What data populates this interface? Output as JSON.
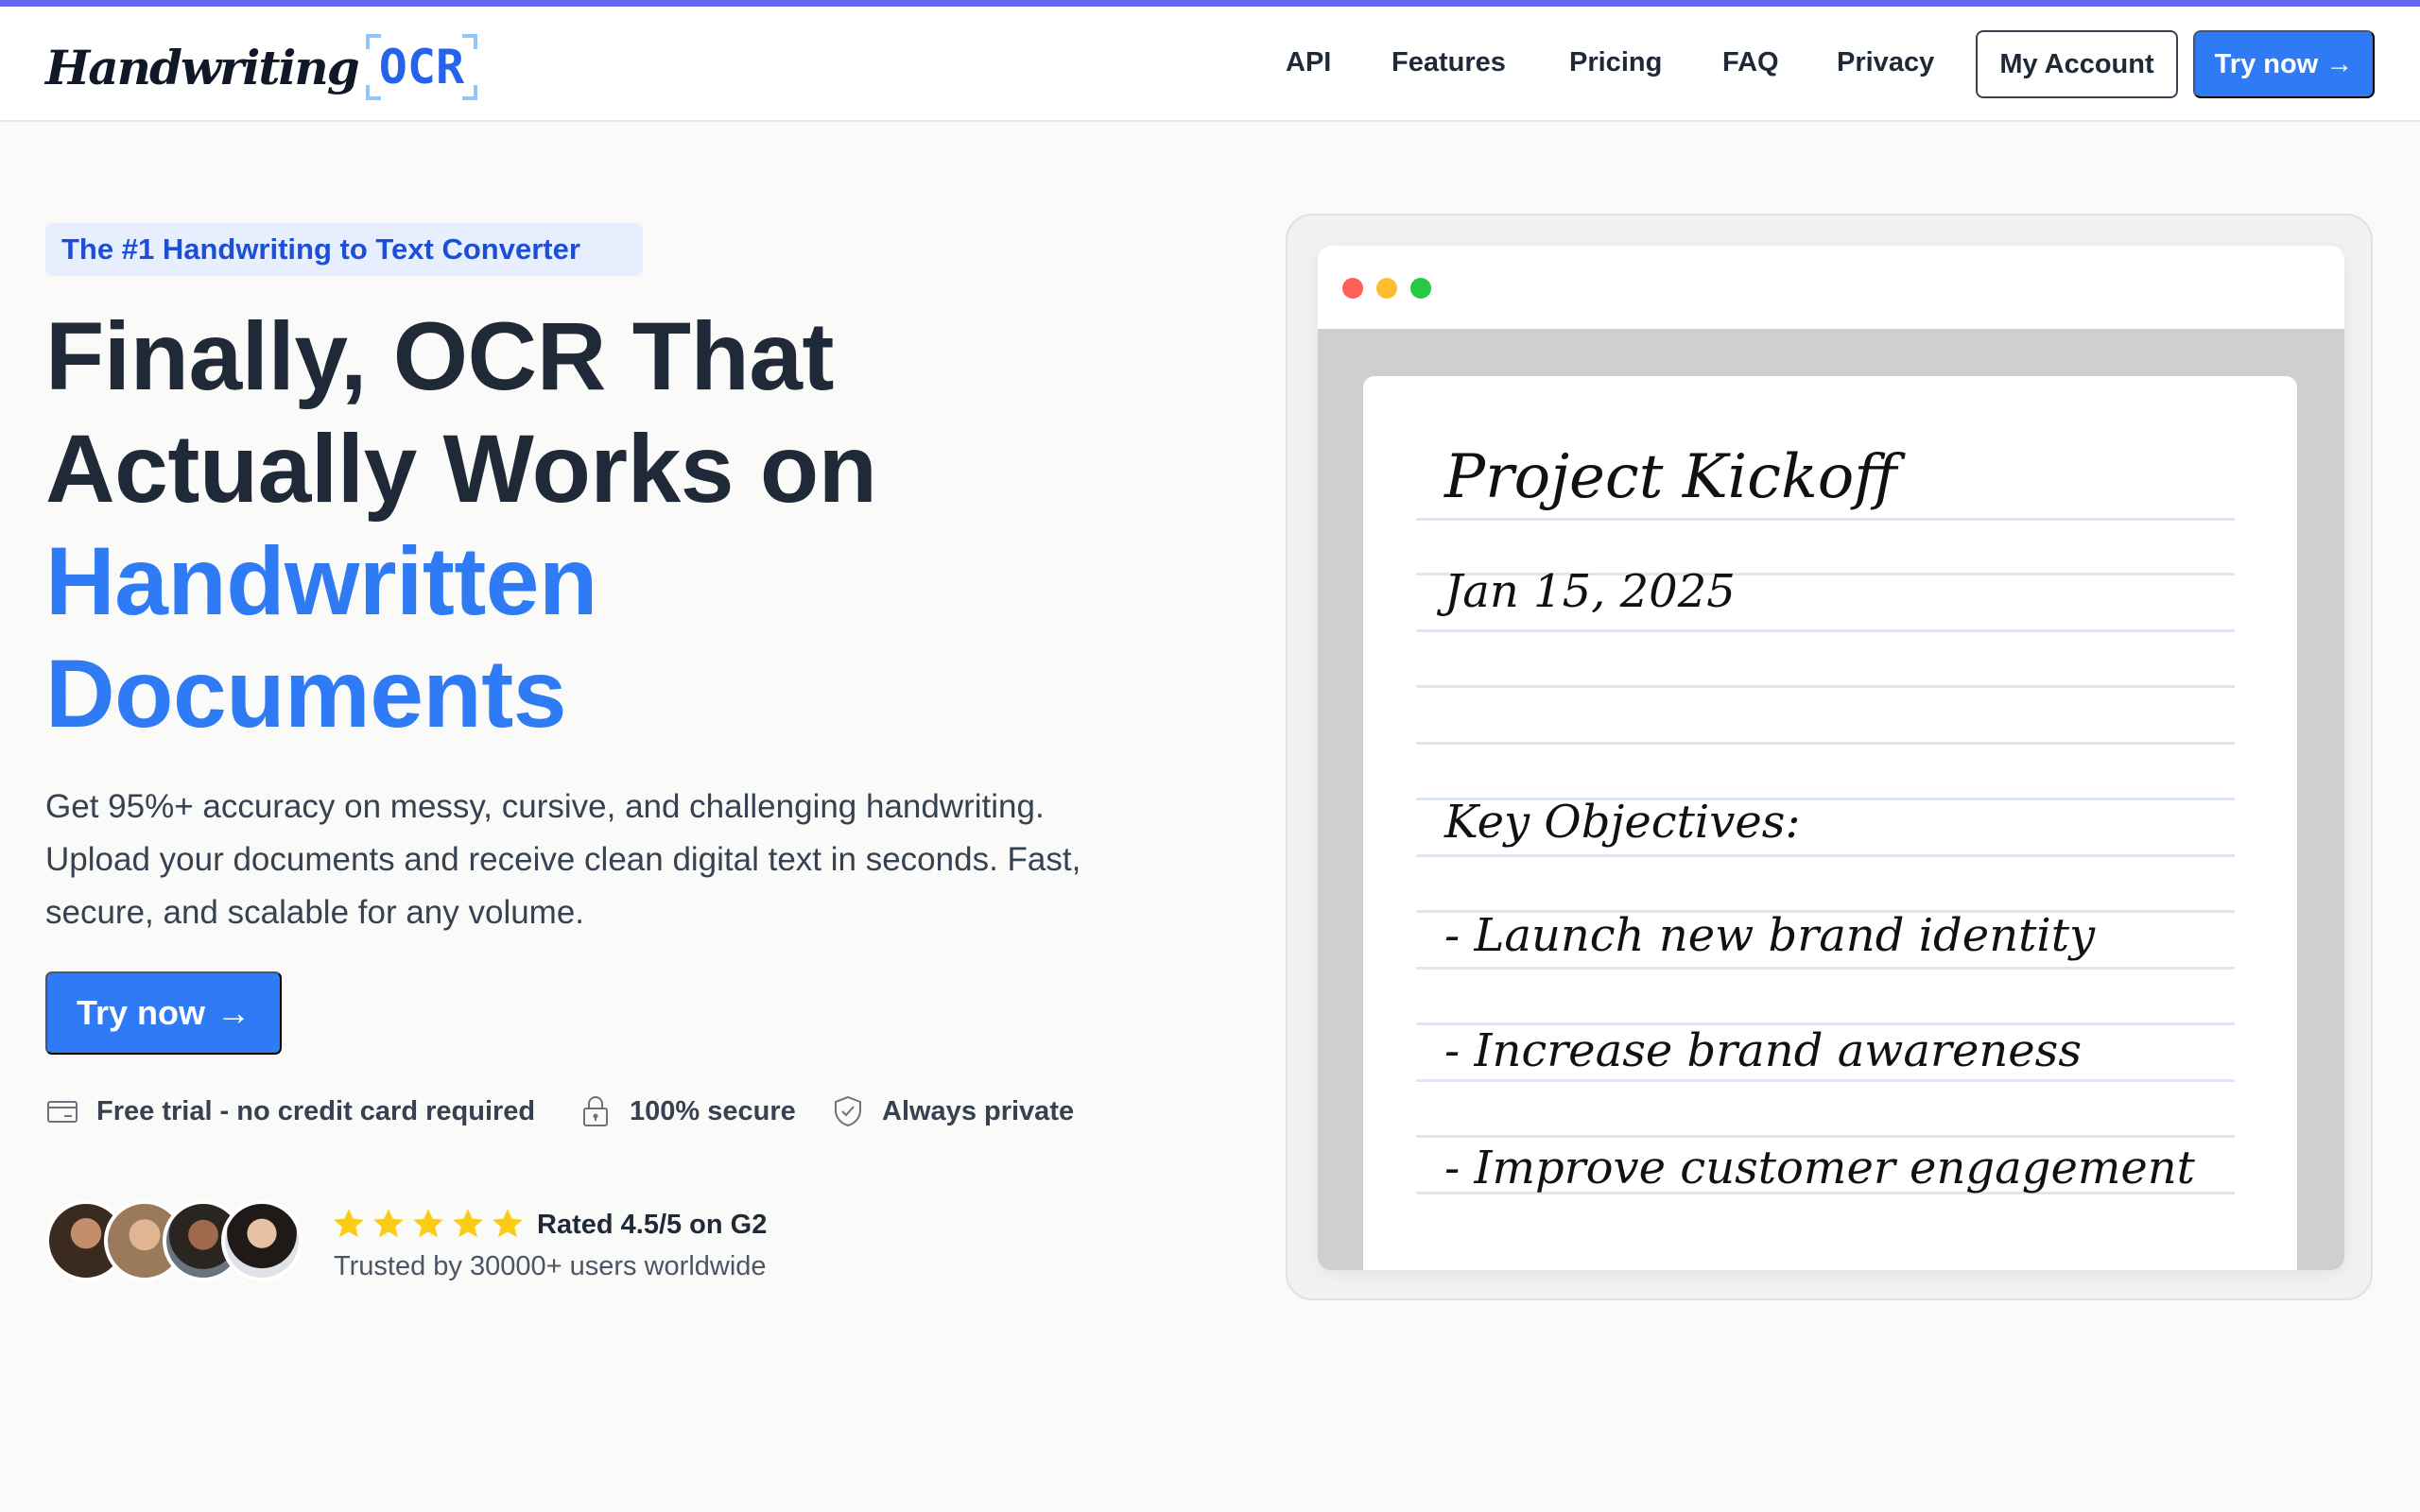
{
  "nav": {
    "logo_script": "Handwriting",
    "logo_mark": "OCR",
    "links": [
      "API",
      "Features",
      "Pricing",
      "FAQ",
      "Privacy"
    ],
    "account_label": "My Account",
    "try_label": "Try now →"
  },
  "hero": {
    "badge": "The #1 Handwriting to Text Converter",
    "headline_line1": "Finally, OCR That",
    "headline_line2": "Actually Works on",
    "headline_line3": "Handwritten",
    "headline_line4": "Documents",
    "subtext": "Get 95%+ accuracy on messy, cursive, and challenging handwriting. Upload your documents and receive clean digital text in seconds. Fast, secure, and scalable for any volume.",
    "cta_label": "Try now",
    "cta_arrow": "→",
    "features": [
      {
        "icon": "credit-card-icon",
        "label": "Free trial - no credit card required"
      },
      {
        "icon": "lock-icon",
        "label": "100% secure"
      },
      {
        "icon": "shield-check-icon",
        "label": "Always private"
      }
    ],
    "rating": "Rated 4.5/5 on G2",
    "rating_value": 4.5,
    "rating_max": 5,
    "trusted": "Trusted by 30000+ users worldwide"
  },
  "preview": {
    "traffic_colors": [
      "#ff5f57",
      "#febc2e",
      "#28c840"
    ],
    "note_lines": [
      "Project Kickoff",
      "Jan 15, 2025",
      "Key Objectives:",
      "- Launch new brand identity",
      "- Increase brand awareness",
      "- Improve customer engagement"
    ]
  },
  "colors": {
    "accent": "#2f7bf5",
    "top_bar": "#6366f1",
    "star": "#facc15"
  }
}
